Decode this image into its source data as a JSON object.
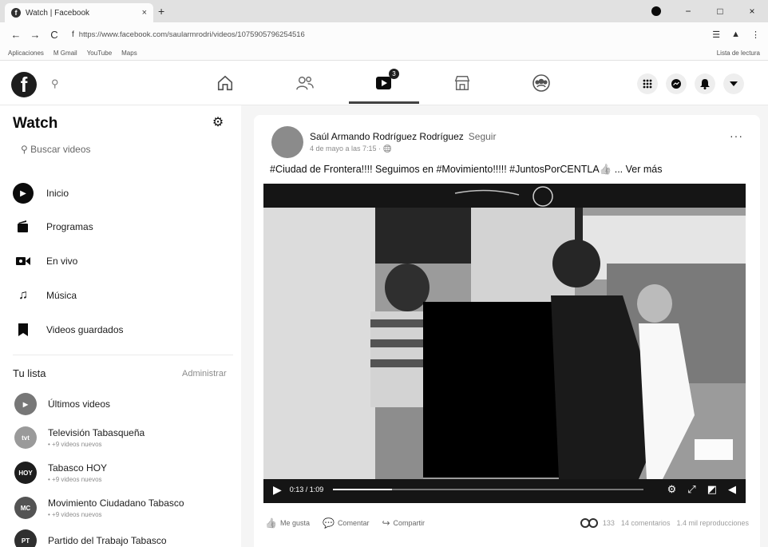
{
  "browser": {
    "tab_title": "Watch | Facebook",
    "tab_close": "×",
    "new_tab": "+",
    "url": "https://www.facebook.com/saularmrodri/videos/1075905796254516",
    "back": "←",
    "forward": "→",
    "reload": "C",
    "minimize": "−",
    "maximize": "□",
    "close": "×",
    "bookmarks": [
      "Aplicaciones",
      "M Gmail",
      "YouTube",
      "Maps"
    ],
    "reading_list": "Lista de lectura"
  },
  "fb": {
    "logo": "f",
    "watch_badge": "3"
  },
  "sidebar": {
    "title": "Watch",
    "search_placeholder": "Buscar videos",
    "items": [
      {
        "label": "Inicio"
      },
      {
        "label": "Programas"
      },
      {
        "label": "En vivo"
      },
      {
        "label": "Música"
      },
      {
        "label": "Videos guardados"
      }
    ],
    "list_title": "Tu lista",
    "manage": "Administrar",
    "list": [
      {
        "name": "Últimos videos",
        "sub": ""
      },
      {
        "name": "Televisión Tabasqueña",
        "sub": "• +9 videos nuevos"
      },
      {
        "name": "Tabasco HOY",
        "sub": "• +9 videos nuevos"
      },
      {
        "name": "Movimiento Ciudadano Tabasco",
        "sub": "• +9 videos nuevos"
      },
      {
        "name": "Partido del Trabajo Tabasco",
        "sub": ""
      }
    ]
  },
  "post": {
    "author": "Saúl Armando Rodríguez Rodríguez",
    "follow": "Seguir",
    "date": "4 de mayo a las 7:15 · 🌐",
    "more": "···",
    "text": "#Ciudad de Frontera!!!! Seguimos en #Movimiento!!!!! #JuntosPorCENTLA👍 ... Ver más",
    "video": {
      "time": "0:13 / 1:09",
      "progress": 0.19
    },
    "actions": {
      "like": "Me gusta",
      "comment": "Comentar",
      "share": "Compartir"
    },
    "stats": {
      "reactions": "133",
      "comments": "14 comentarios",
      "views": "1.4 mil reproducciones"
    }
  },
  "colors": {
    "nav_bg": "#ffffff",
    "feed_bg": "#efefef"
  }
}
